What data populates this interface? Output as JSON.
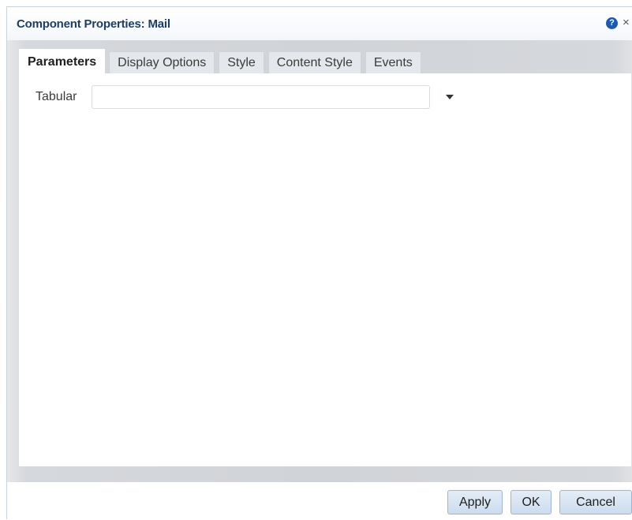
{
  "dialog": {
    "title": "Component Properties: Mail",
    "help_icon_glyph": "?",
    "close_icon_glyph": "×"
  },
  "tabs": [
    {
      "label": "Parameters",
      "active": true
    },
    {
      "label": "Display Options",
      "active": false
    },
    {
      "label": "Style",
      "active": false
    },
    {
      "label": "Content Style",
      "active": false
    },
    {
      "label": "Events",
      "active": false
    }
  ],
  "parameters": {
    "tabular_label": "Tabular",
    "tabular_value": ""
  },
  "footer": {
    "apply_label": "Apply",
    "ok_label": "OK",
    "cancel_label": "Cancel"
  },
  "colors": {
    "title_text": "#1f3d63",
    "help_icon_bg": "#1e5aa8",
    "button_border": "#9fb5cf",
    "button_bg_top": "#e4edf7",
    "button_bg_bottom": "#ccdcee",
    "frame_bg": "#d0d3d7"
  },
  "icons": {
    "help": "help-icon",
    "close": "close-icon",
    "dropdown": "chevron-down-icon"
  }
}
